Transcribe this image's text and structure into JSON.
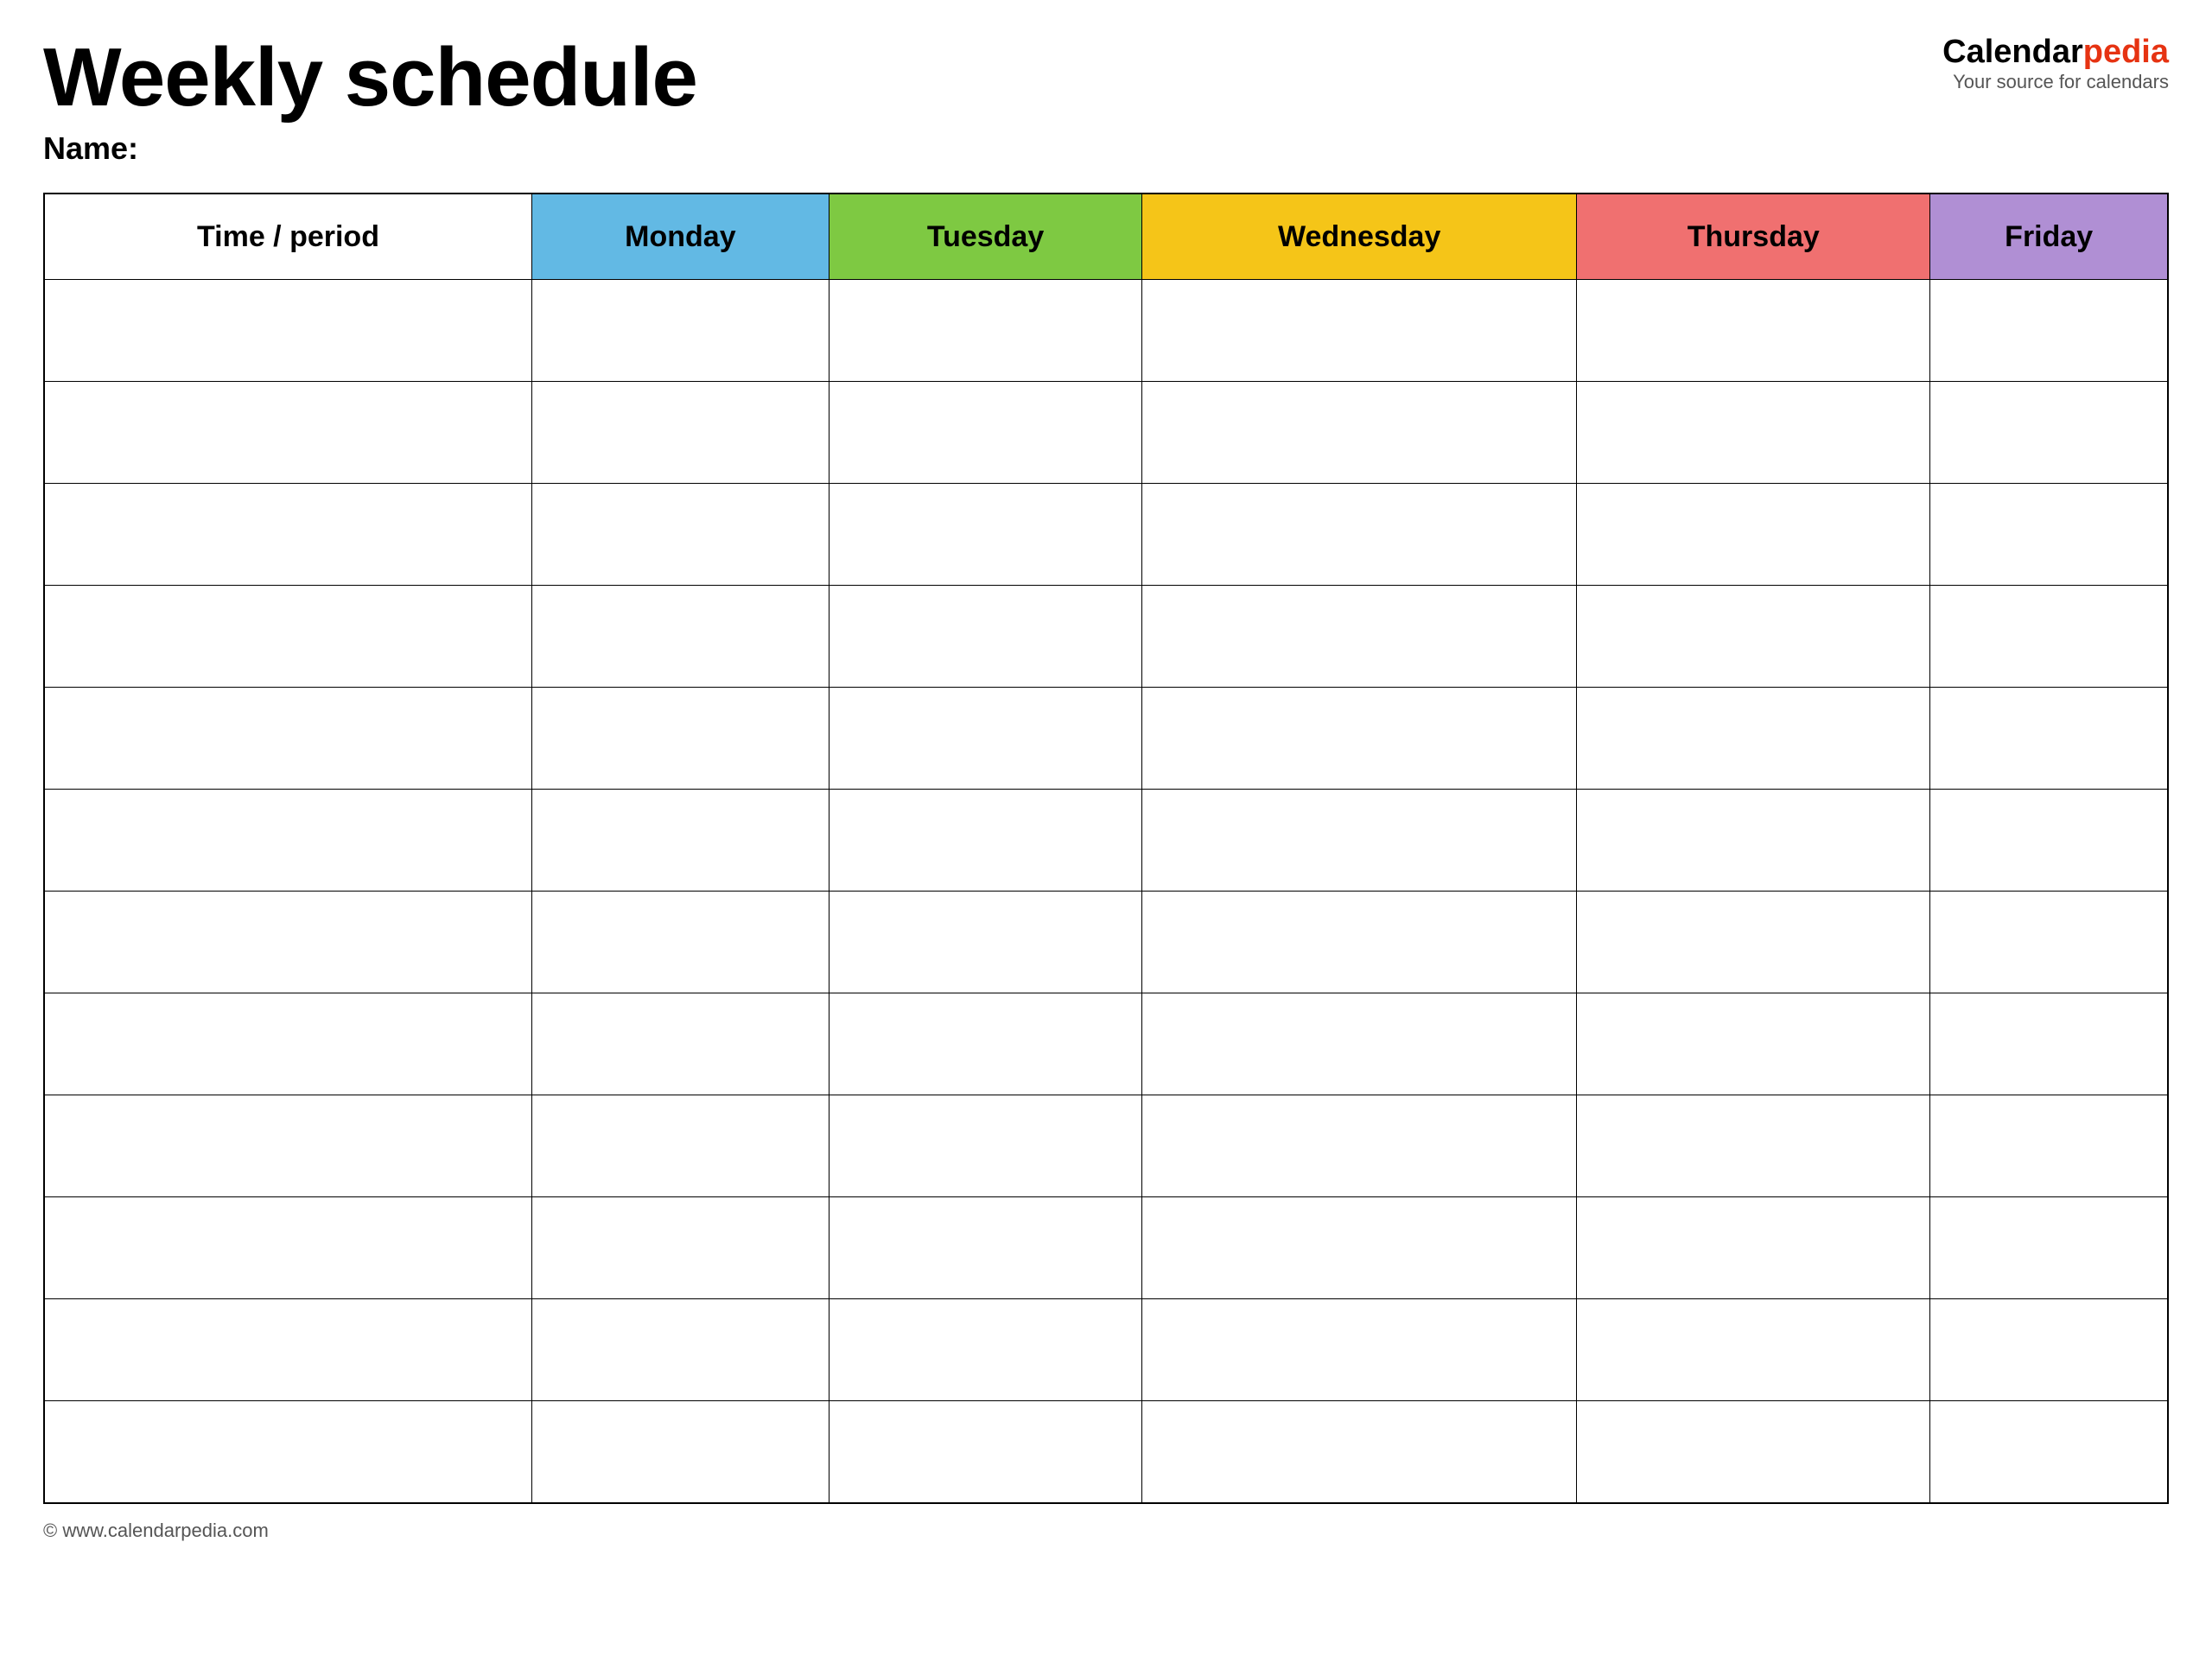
{
  "header": {
    "title": "Weekly schedule",
    "name_label": "Name:",
    "logo_calendar": "Calendar",
    "logo_pedia": "pedia",
    "logo_tagline": "Your source for calendars"
  },
  "table": {
    "columns": [
      {
        "id": "time",
        "label": "Time / period",
        "color": "#ffffff"
      },
      {
        "id": "monday",
        "label": "Monday",
        "color": "#62b9e4"
      },
      {
        "id": "tuesday",
        "label": "Tuesday",
        "color": "#7ec942"
      },
      {
        "id": "wednesday",
        "label": "Wednesday",
        "color": "#f5c518"
      },
      {
        "id": "thursday",
        "label": "Thursday",
        "color": "#f07070"
      },
      {
        "id": "friday",
        "label": "Friday",
        "color": "#b08fd4"
      }
    ],
    "row_count": 12
  },
  "footer": {
    "url": "© www.calendarpedia.com"
  }
}
